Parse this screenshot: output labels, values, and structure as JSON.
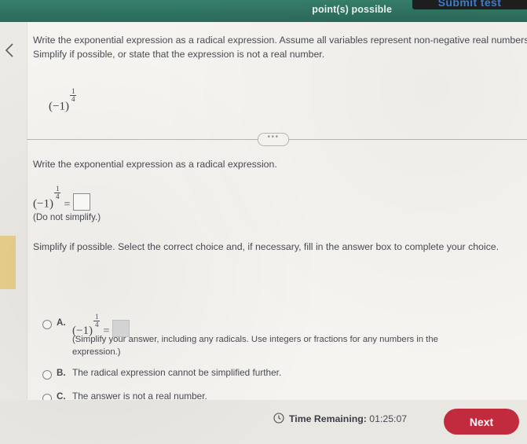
{
  "header": {
    "points_possible": "point(s) possible",
    "submit_test_label": "Submit test"
  },
  "sidebar": {
    "prev_icon": "chevron-left-icon"
  },
  "question": {
    "prompt": "Write the exponential expression as a radical expression. Assume all variables represent non-negative real numbers. Simplify if possible, or state that the expression is not a real number.",
    "expression": {
      "base": "(−1)",
      "exp_num": "1",
      "exp_den": "4"
    }
  },
  "divider": {
    "ellipsis": "•••"
  },
  "step1": {
    "instruction": "Write the exponential expression as a radical expression.",
    "expression": {
      "base": "(−1)",
      "exp_num": "1",
      "exp_den": "4"
    },
    "equals": "=",
    "note": "(Do not simplify.)"
  },
  "step2": {
    "instruction": "Simplify if possible. Select the correct choice and, if necessary, fill in the answer box to complete your choice.",
    "choices": [
      {
        "letter": "A.",
        "expression": {
          "base": "(−1)",
          "exp_num": "1",
          "exp_den": "4"
        },
        "equals": "=",
        "note": "(Simplify your answer, including any radicals. Use integers or fractions for any numbers in the expression.)"
      },
      {
        "letter": "B.",
        "text": "The radical expression cannot be simplified further."
      },
      {
        "letter": "C.",
        "text": "The answer is not a real number."
      }
    ]
  },
  "footer": {
    "clock_icon": "clock-icon",
    "time_label": "Time Remaining:",
    "time_value": "01:25:07",
    "next_label": "Next"
  },
  "colors": {
    "header_green": "#357a68",
    "next_red": "#c22a3e",
    "highlight_yellow": "#e8d08a",
    "page_bg": "#f5f4f0"
  }
}
